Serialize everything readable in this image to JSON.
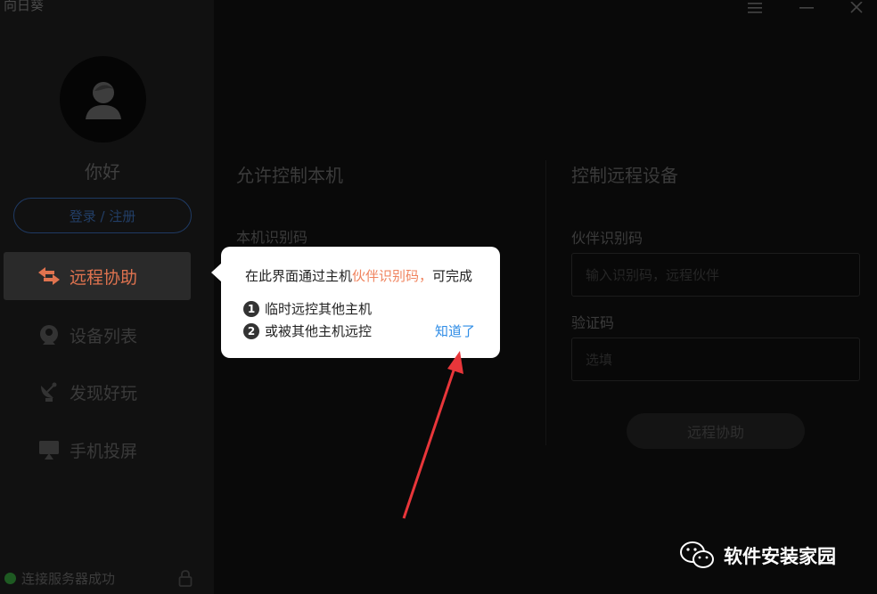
{
  "window": {
    "title": "向日葵"
  },
  "sidebar": {
    "greeting": "你好",
    "login_label": "登录 / 注册",
    "items": [
      {
        "label": "远程协助",
        "icon": "swap-arrows-icon",
        "active": true
      },
      {
        "label": "设备列表",
        "icon": "device-list-icon",
        "active": false
      },
      {
        "label": "发现好玩",
        "icon": "satellite-icon",
        "active": false
      },
      {
        "label": "手机投屏",
        "icon": "screen-cast-icon",
        "active": false
      }
    ],
    "status": "连接服务器成功"
  },
  "allow": {
    "title": "允许控制本机",
    "id_label": "本机识别码",
    "masked_code": "••••••"
  },
  "control": {
    "title": "控制远程设备",
    "partner_label": "伙伴识别码",
    "partner_placeholder": "输入识别码，远程伙伴",
    "verify_label": "验证码",
    "verify_placeholder": "选填",
    "button_label": "远程协助"
  },
  "tooltip": {
    "line1_prefix": "在此界面通过主机",
    "line1_highlight": "伙伴识别码，",
    "line1_suffix": "可完成",
    "item1_num": "1",
    "item1": "临时远控其他主机",
    "item2_num": "2",
    "item2": "或被其他主机远控",
    "dismiss": "知道了"
  },
  "watermark": {
    "text": "软件安装家园"
  },
  "colors": {
    "accent": "#e0734f",
    "highlight": "#f0845f",
    "link": "#2e8ce6",
    "arrow": "#e8363a",
    "status_ok": "#1e5a22"
  }
}
